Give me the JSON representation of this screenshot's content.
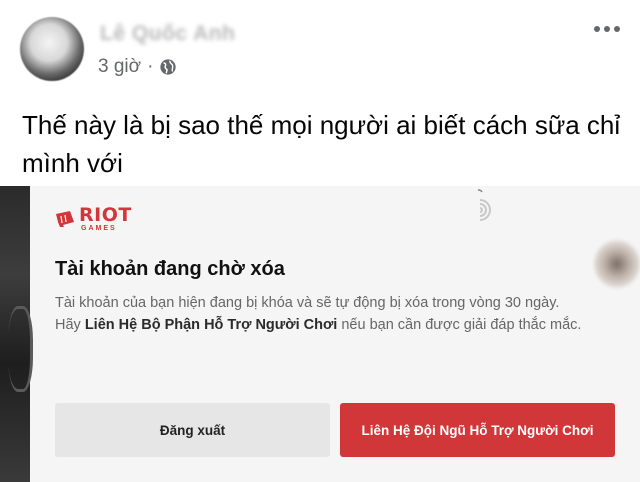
{
  "post": {
    "author_name": "Lê Quốc Anh",
    "time": "3 giờ",
    "separator": "·",
    "text": "Thế này là bị sao thế mọi người ai biết cách sữa chỉ mình với"
  },
  "dialog": {
    "brand_line1": "RIOT",
    "brand_line2": "GAMES",
    "title": "Tài khoản đang chờ xóa",
    "body_line1": "Tài khoản của bạn hiện đang bị khóa và sẽ tự động bị xóa trong vòng 30 ngày.",
    "body_prefix": "Hãy ",
    "body_link": "Liên Hệ Bộ Phận Hỗ Trợ Người Chơi",
    "body_suffix": " nếu bạn cần được giải đáp thắc mắc.",
    "logout_label": "Đăng xuất",
    "contact_label": "Liên Hệ Đội Ngũ Hỗ Trợ Người Chơi"
  },
  "colors": {
    "riot_red": "#d13639",
    "meta_gray": "#65676b"
  },
  "icons": {
    "privacy": "globe-icon",
    "menu": "more-icon",
    "loading": "spinner-icon"
  }
}
